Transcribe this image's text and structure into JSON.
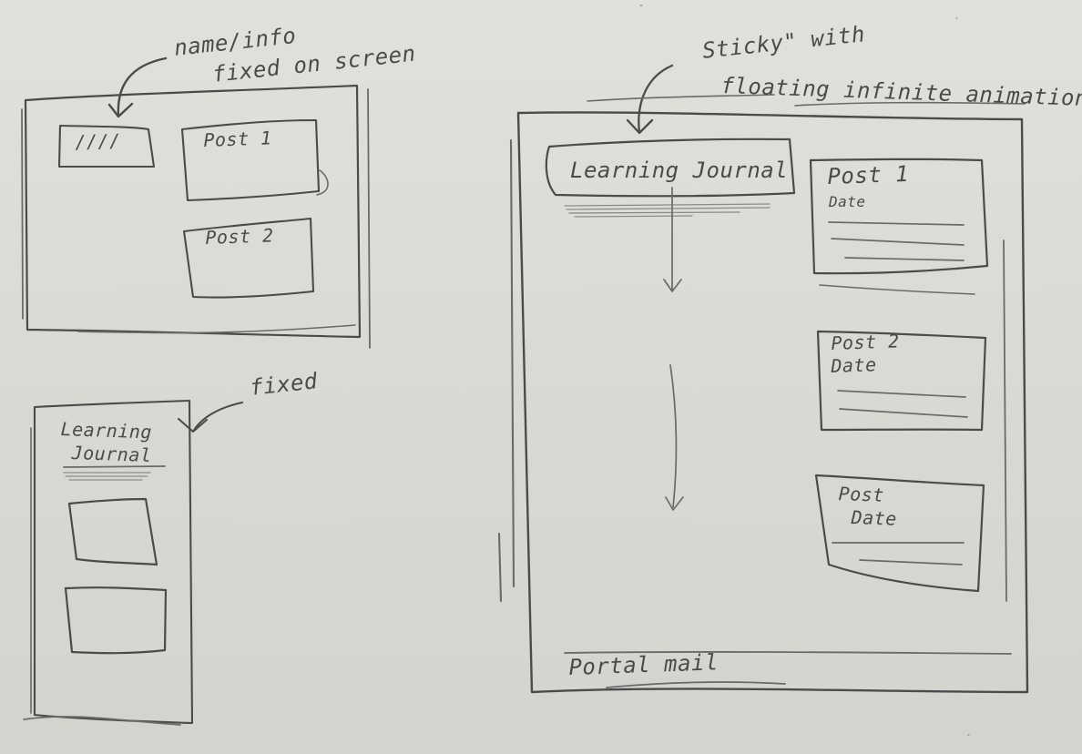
{
  "annotations": {
    "desktop_name_info_line1": "name/info",
    "desktop_name_info_line2": "fixed on screen",
    "mobile_fixed": "fixed",
    "sticky_line1": "Sticky\" with",
    "sticky_line2": "floating infinite animation"
  },
  "desktop_small": {
    "name_placeholder": "////",
    "post_1": "Post 1",
    "post_2": "Post 2"
  },
  "mobile": {
    "title_line1": "Learning",
    "title_line2": "Journal"
  },
  "desktop_large": {
    "header": "Learning Journal",
    "post_1_title": "Post 1",
    "post_1_date": "Date",
    "post_2_title": "Post 2",
    "post_2_date": "Date",
    "post_3_title": "Post",
    "post_3_date": "Date",
    "footer": "Portal mail"
  }
}
